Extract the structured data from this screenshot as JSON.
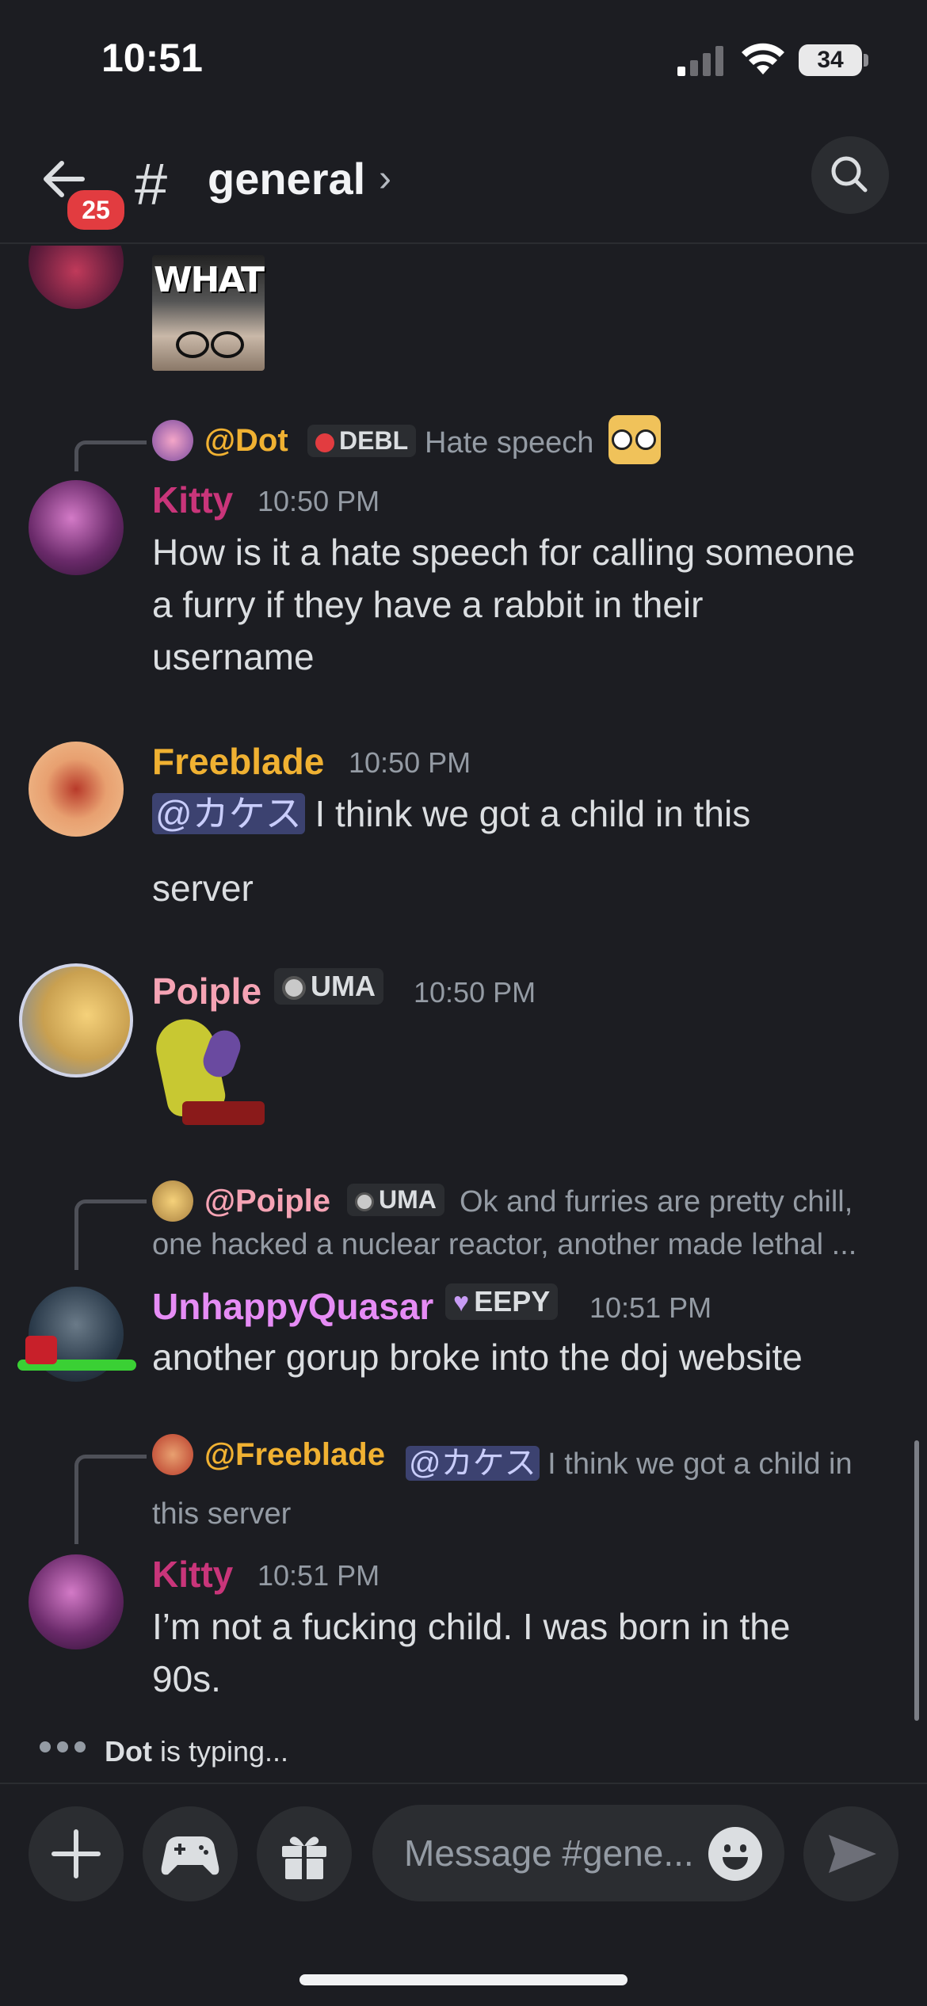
{
  "status": {
    "time": "10:51",
    "battery": "34"
  },
  "header": {
    "title": "general",
    "unread_count": "25"
  },
  "messages": [
    {
      "type": "sticker_only",
      "text": "WHAT"
    },
    {
      "reply": {
        "user": "@Dot",
        "role": "DEBL",
        "text": "Hate speech"
      },
      "user": "Kitty",
      "time": "10:50 PM",
      "text_lines": [
        "How is it a hate speech for calling someone",
        "a furry if they have a rabbit in their",
        "username"
      ]
    },
    {
      "user": "Freeblade",
      "time": "10:50 PM",
      "mention": "@カケス",
      "text": " I think we got a child in this",
      "text2": "server"
    },
    {
      "user": "Poiple",
      "role": "UMA",
      "time": "10:50 PM"
    },
    {
      "reply": {
        "user": "@Poiple",
        "role": "UMA",
        "text1": "Ok and furries are pretty chill,",
        "text2": "one hacked a nuclear reactor, another made lethal ..."
      },
      "user": "UnhappyQuasar",
      "role": "EEPY",
      "time": "10:51 PM",
      "text": "another gorup broke into the doj website"
    },
    {
      "reply": {
        "user": "@Freeblade",
        "mention": "@カケス",
        "text1": " I think we got a child in",
        "text2": "this server"
      },
      "user": "Kitty",
      "time": "10:51 PM",
      "text_lines": [
        "I’m not a fucking child. I was born in the",
        "90s."
      ]
    }
  ],
  "typing": {
    "user": "Dot",
    "suffix": " is typing..."
  },
  "composer": {
    "placeholder": "Message #gene..."
  },
  "colors": {
    "kitty": "#c9357a",
    "dot": "#f0b132",
    "freeblade": "#f0b132",
    "poiple": "#f5a3b4",
    "quasar": "#e68cf5",
    "mention_bg": "#3c4270"
  }
}
